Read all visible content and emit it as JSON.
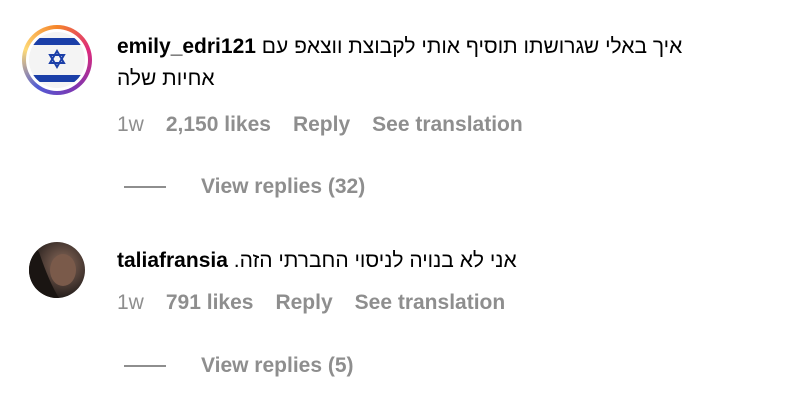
{
  "comments": [
    {
      "username": "emily_edri121",
      "text_line1": "איך באלי שגרושתו תוסיף אותי לקבוצת ווצאפ עם",
      "text_line2": "אחיות שלה",
      "time": "1w",
      "likes": "2,150 likes",
      "reply_label": "Reply",
      "translate_label": "See translation",
      "view_replies": "View replies (32)",
      "avatar_icon": "israel-flag-icon"
    },
    {
      "username": "taliafransia",
      "text_line1": "אני לא בנויה לניסוי החברתי הזה.",
      "time": "1w",
      "likes": "791 likes",
      "reply_label": "Reply",
      "translate_label": "See translation",
      "view_replies": "View replies (5)",
      "avatar_icon": "profile-photo"
    }
  ],
  "colors": {
    "meta_gray": "#8e8e8e",
    "flag_blue": "#1b3fa8",
    "story_ring": "#dd2a7b"
  }
}
